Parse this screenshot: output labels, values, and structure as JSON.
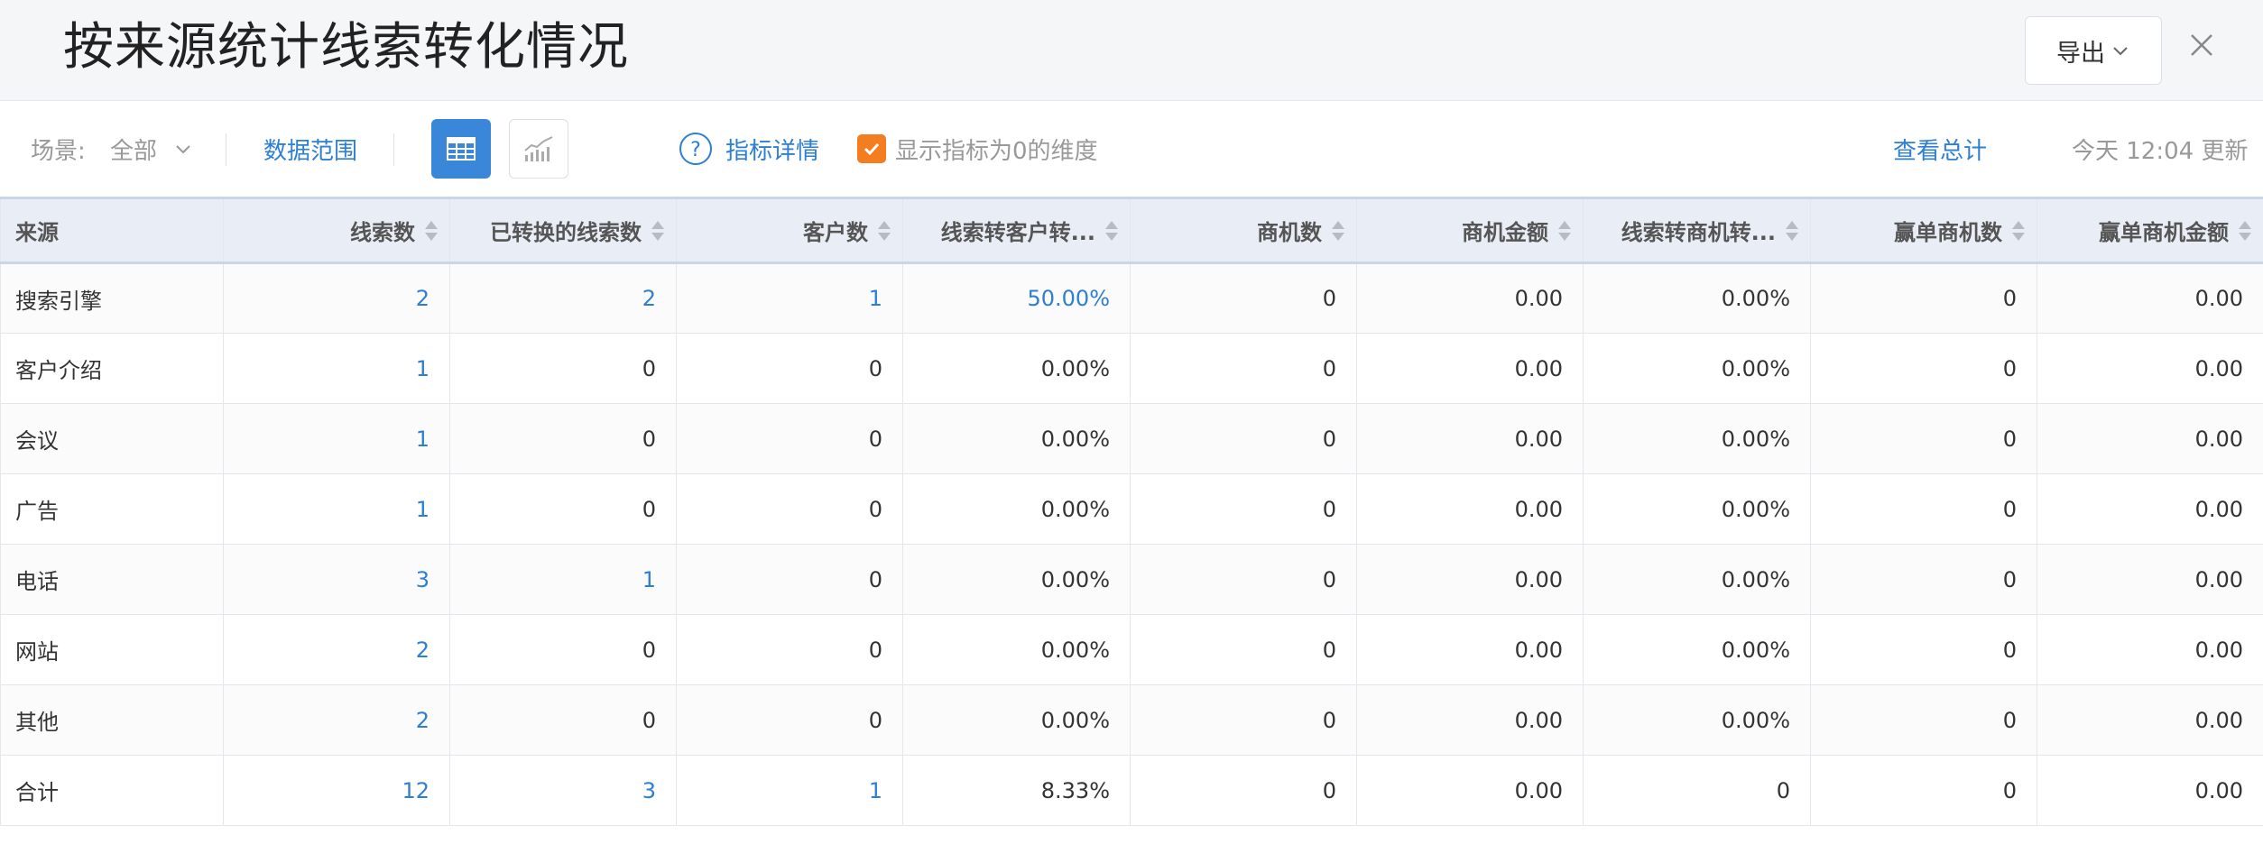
{
  "header": {
    "title": "按来源统计线索转化情况",
    "export_label": "导出"
  },
  "toolbar": {
    "scene_label": "场景:",
    "scene_value": "全部",
    "range_label": "数据范围",
    "metric_label": "指标详情",
    "zero_label": "显示指标为0的维度",
    "zero_checked": true,
    "total_label": "查看总计",
    "updated_label": "今天 12:04 更新"
  },
  "table": {
    "columns": [
      "来源",
      "线索数",
      "已转换的线索数",
      "客户数",
      "线索转客户转...",
      "商机数",
      "商机金额",
      "线索转商机转...",
      "赢单商机数",
      "赢单商机金额"
    ],
    "rows": [
      [
        "搜索引擎",
        "2",
        "2",
        "1",
        "50.00%",
        "0",
        "0.00",
        "0.00%",
        "0",
        "0.00"
      ],
      [
        "客户介绍",
        "1",
        "0",
        "0",
        "0.00%",
        "0",
        "0.00",
        "0.00%",
        "0",
        "0.00"
      ],
      [
        "会议",
        "1",
        "0",
        "0",
        "0.00%",
        "0",
        "0.00",
        "0.00%",
        "0",
        "0.00"
      ],
      [
        "广告",
        "1",
        "0",
        "0",
        "0.00%",
        "0",
        "0.00",
        "0.00%",
        "0",
        "0.00"
      ],
      [
        "电话",
        "3",
        "1",
        "0",
        "0.00%",
        "0",
        "0.00",
        "0.00%",
        "0",
        "0.00"
      ],
      [
        "网站",
        "2",
        "0",
        "0",
        "0.00%",
        "0",
        "0.00",
        "0.00%",
        "0",
        "0.00"
      ],
      [
        "其他",
        "2",
        "0",
        "0",
        "0.00%",
        "0",
        "0.00",
        "0.00%",
        "0",
        "0.00"
      ],
      [
        "合计",
        "12",
        "3",
        "1",
        "8.33%",
        "0",
        "0.00",
        "0",
        "0",
        "0.00"
      ]
    ]
  },
  "colors": {
    "accent": "#2d7fd3",
    "checkbox": "#f47d1f",
    "header_bg": "#e9eef6"
  }
}
